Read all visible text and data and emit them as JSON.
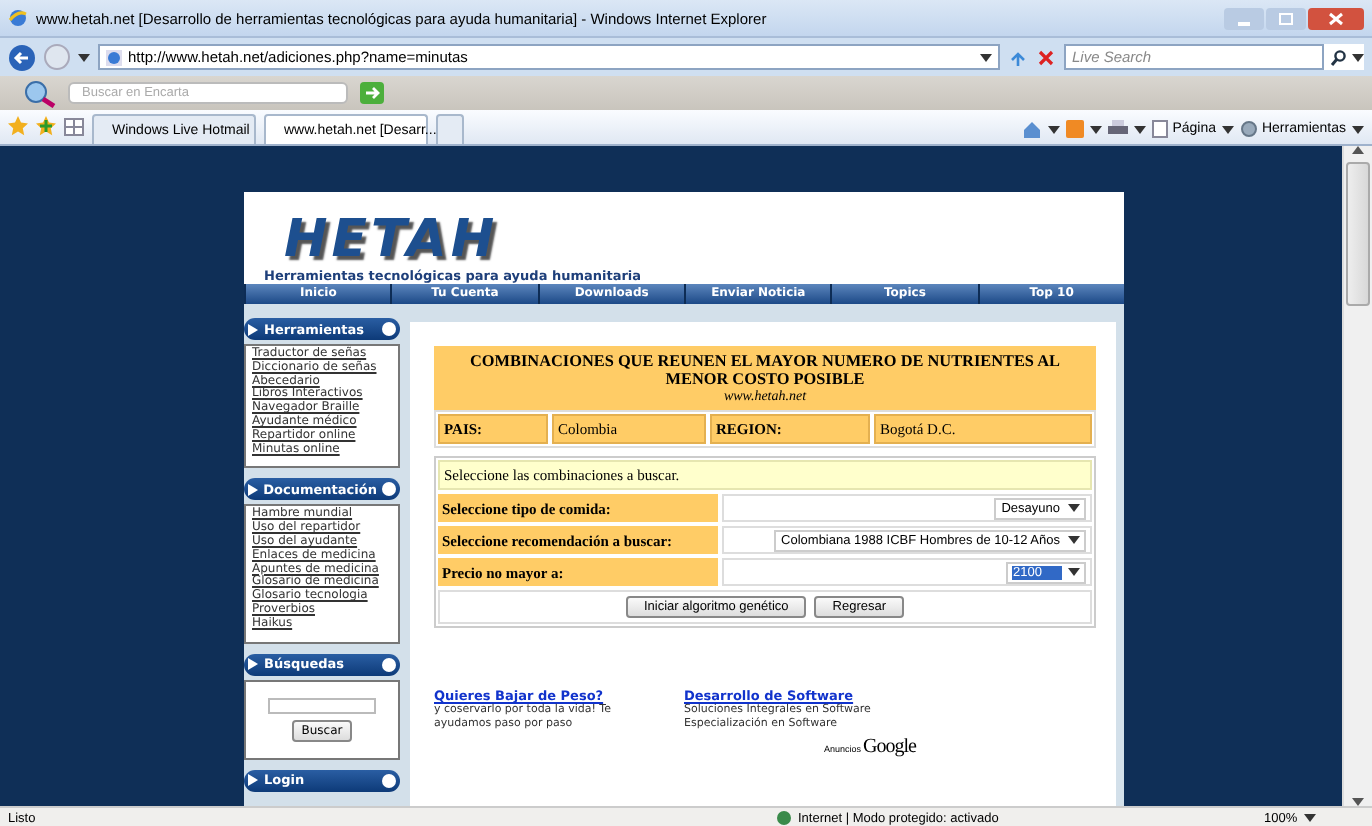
{
  "window": {
    "title": "www.hetah.net [Desarrollo de herramientas tecnológicas para ayuda humanitaria] - Windows Internet Explorer"
  },
  "address_bar": {
    "url": "http://www.hetah.net/adiciones.php?name=minutas"
  },
  "live_search": {
    "placeholder": "Live Search"
  },
  "encarta": {
    "placeholder": "Buscar en Encarta"
  },
  "tabs": [
    {
      "label": "Windows Live Hotmail",
      "selected": false
    },
    {
      "label": "www.hetah.net [Desarr...",
      "selected": true
    }
  ],
  "command_bar": [
    "Página",
    "Herramientas"
  ],
  "site": {
    "logo": "HETAH",
    "tagline": "Herramientas tecnológicas para ayuda humanitaria",
    "nav": [
      "Inicio",
      "Tu Cuenta",
      "Downloads",
      "Enviar Noticia",
      "Topics",
      "Top 10"
    ],
    "sidebar": [
      {
        "title": "Herramientas",
        "kind": "links",
        "items": [
          "Traductor de señas",
          "Diccionario de señas",
          "Abecedario",
          "Libros Interactivos",
          "Navegador Braille",
          "Ayudante médico",
          "Repartidor online",
          "Minutas online"
        ]
      },
      {
        "title": "Documentación",
        "kind": "links",
        "items": [
          "Hambre mundial",
          "Uso del repartidor",
          "Uso del ayudante",
          "Enlaces de medicina",
          "Apuntes de medicina",
          "Glosario de medicina",
          "Glosario tecnologia",
          "Proverbios",
          "Haikus"
        ]
      },
      {
        "title": "Búsquedas",
        "kind": "search",
        "button": "Buscar"
      },
      {
        "title": "Login",
        "kind": "header"
      }
    ],
    "form": {
      "title": "COMBINACIONES QUE REUNEN EL MAYOR NUMERO DE NUTRIENTES AL MENOR COSTO POSIBLE",
      "subtitle": "www.hetah.net",
      "info": [
        "PAIS:",
        "Colombia",
        "REGION:",
        "Bogotá D.C."
      ],
      "prompt": "Seleccione las combinaciones a buscar.",
      "fields": [
        {
          "label": "Seleccione tipo de comida:",
          "value": "Desayuno",
          "selected": false
        },
        {
          "label": "Seleccione recomendación a buscar:",
          "value": "Colombiana 1988 ICBF Hombres de 10-12 Años",
          "selected": false
        },
        {
          "label": "Precio no mayor a:",
          "value": "2100",
          "selected": true
        }
      ],
      "buttons": [
        "Iniciar algoritmo genético",
        "Regresar"
      ]
    },
    "ads": [
      {
        "title": "Quieres Bajar de Peso?",
        "text": "y coservarlo por toda la vida! Te ayudamos paso por paso"
      },
      {
        "title": "Desarrollo de Software",
        "text": "Soluciones Integrales en Software Especialización en Software"
      }
    ],
    "ads_label": [
      "Anuncios",
      "Google"
    ]
  },
  "status_bar": {
    "text": "Listo",
    "zone": "Internet | Modo protegido: activado",
    "zoom": "100%"
  }
}
